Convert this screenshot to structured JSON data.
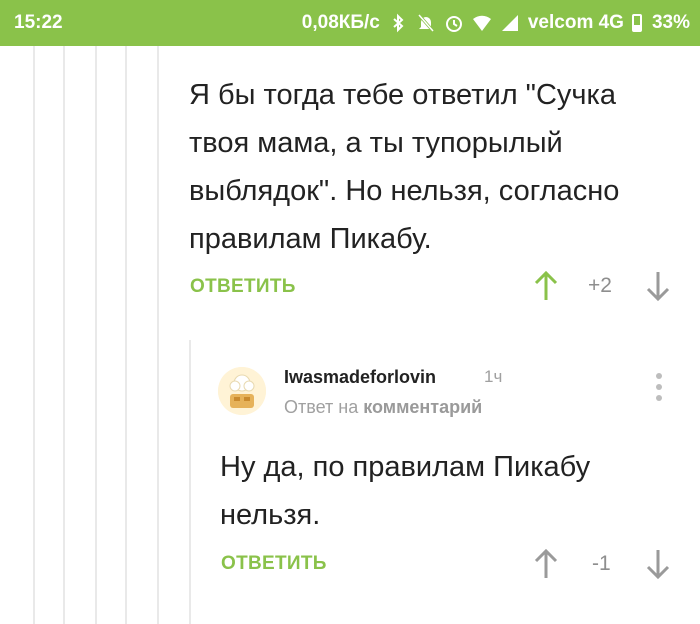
{
  "status_bar": {
    "time": "15:22",
    "speed": "0,08КБ/с",
    "carrier": "velcom 4G",
    "battery": "33%",
    "color": "#8ac24a"
  },
  "comment": {
    "text_lines": [
      "Я бы тогда тебе ответил \"Сучка",
      "твоя мама, а ты тупорылый",
      "выблядок\". Но нельзя, согласно",
      "правилам Пикабу."
    ],
    "reply_label": "ОТВЕТИТЬ",
    "score": "+2",
    "upvote_color": "#8ac24a"
  },
  "reply": {
    "username": "Iwasmadeforlovin",
    "time_ago": "1ч",
    "meta_prefix": "Ответ на",
    "meta_link": "комментарий",
    "text_lines": [
      "Ну да, по правилам Пикабу",
      "нельзя."
    ],
    "reply_label": "ОТВЕТИТЬ",
    "score": "-1"
  }
}
